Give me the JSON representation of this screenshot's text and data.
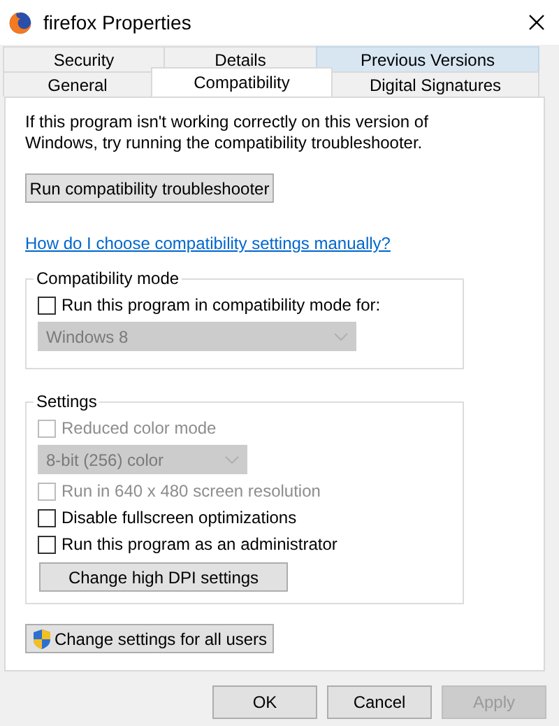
{
  "window": {
    "title": "firefox Properties"
  },
  "tab_rows": [
    [
      {
        "label": "Security",
        "selected": false,
        "hovered": false
      },
      {
        "label": "Details",
        "selected": false,
        "hovered": false
      },
      {
        "label": "Previous Versions",
        "selected": false,
        "hovered": true
      }
    ],
    [
      {
        "label": "General",
        "selected": false,
        "hovered": false
      },
      {
        "label": "Compatibility",
        "selected": true,
        "hovered": false
      },
      {
        "label": "Digital Signatures",
        "selected": false,
        "hovered": false
      }
    ]
  ],
  "intro": "If this program isn't working correctly on this version of Windows, try running the compatibility troubleshooter.",
  "troubleshooter_button": {
    "label": "Run compatibility troubleshooter"
  },
  "help_link": "How do I choose compatibility settings manually?",
  "groups": [
    {
      "title": "Compatibility mode",
      "items": [
        {
          "kind": "checkbox",
          "label": "Run this program in compatibility mode for:",
          "checked": false,
          "disabled": false
        },
        {
          "kind": "dropdown",
          "value": "Windows 8",
          "disabled": true
        }
      ]
    },
    {
      "title": "Settings",
      "items": [
        {
          "kind": "checkbox",
          "label": "Reduced color mode",
          "checked": false,
          "disabled": true
        },
        {
          "kind": "dropdown",
          "value": "8-bit (256) color",
          "disabled": true
        },
        {
          "kind": "checkbox",
          "label": "Run in 640 x 480 screen resolution",
          "checked": false,
          "disabled": true
        },
        {
          "kind": "checkbox",
          "label": "Disable fullscreen optimizations",
          "checked": false,
          "disabled": false
        },
        {
          "kind": "checkbox",
          "label": "Run this program as an administrator",
          "checked": false,
          "disabled": false
        },
        {
          "kind": "button",
          "label": "Change high DPI settings",
          "disabled": false
        }
      ]
    }
  ],
  "all_users_button": {
    "label": "Change settings for all users"
  },
  "footer_buttons": [
    {
      "label": "OK",
      "disabled": false
    },
    {
      "label": "Cancel",
      "disabled": false
    },
    {
      "label": "Apply",
      "disabled": true
    }
  ]
}
